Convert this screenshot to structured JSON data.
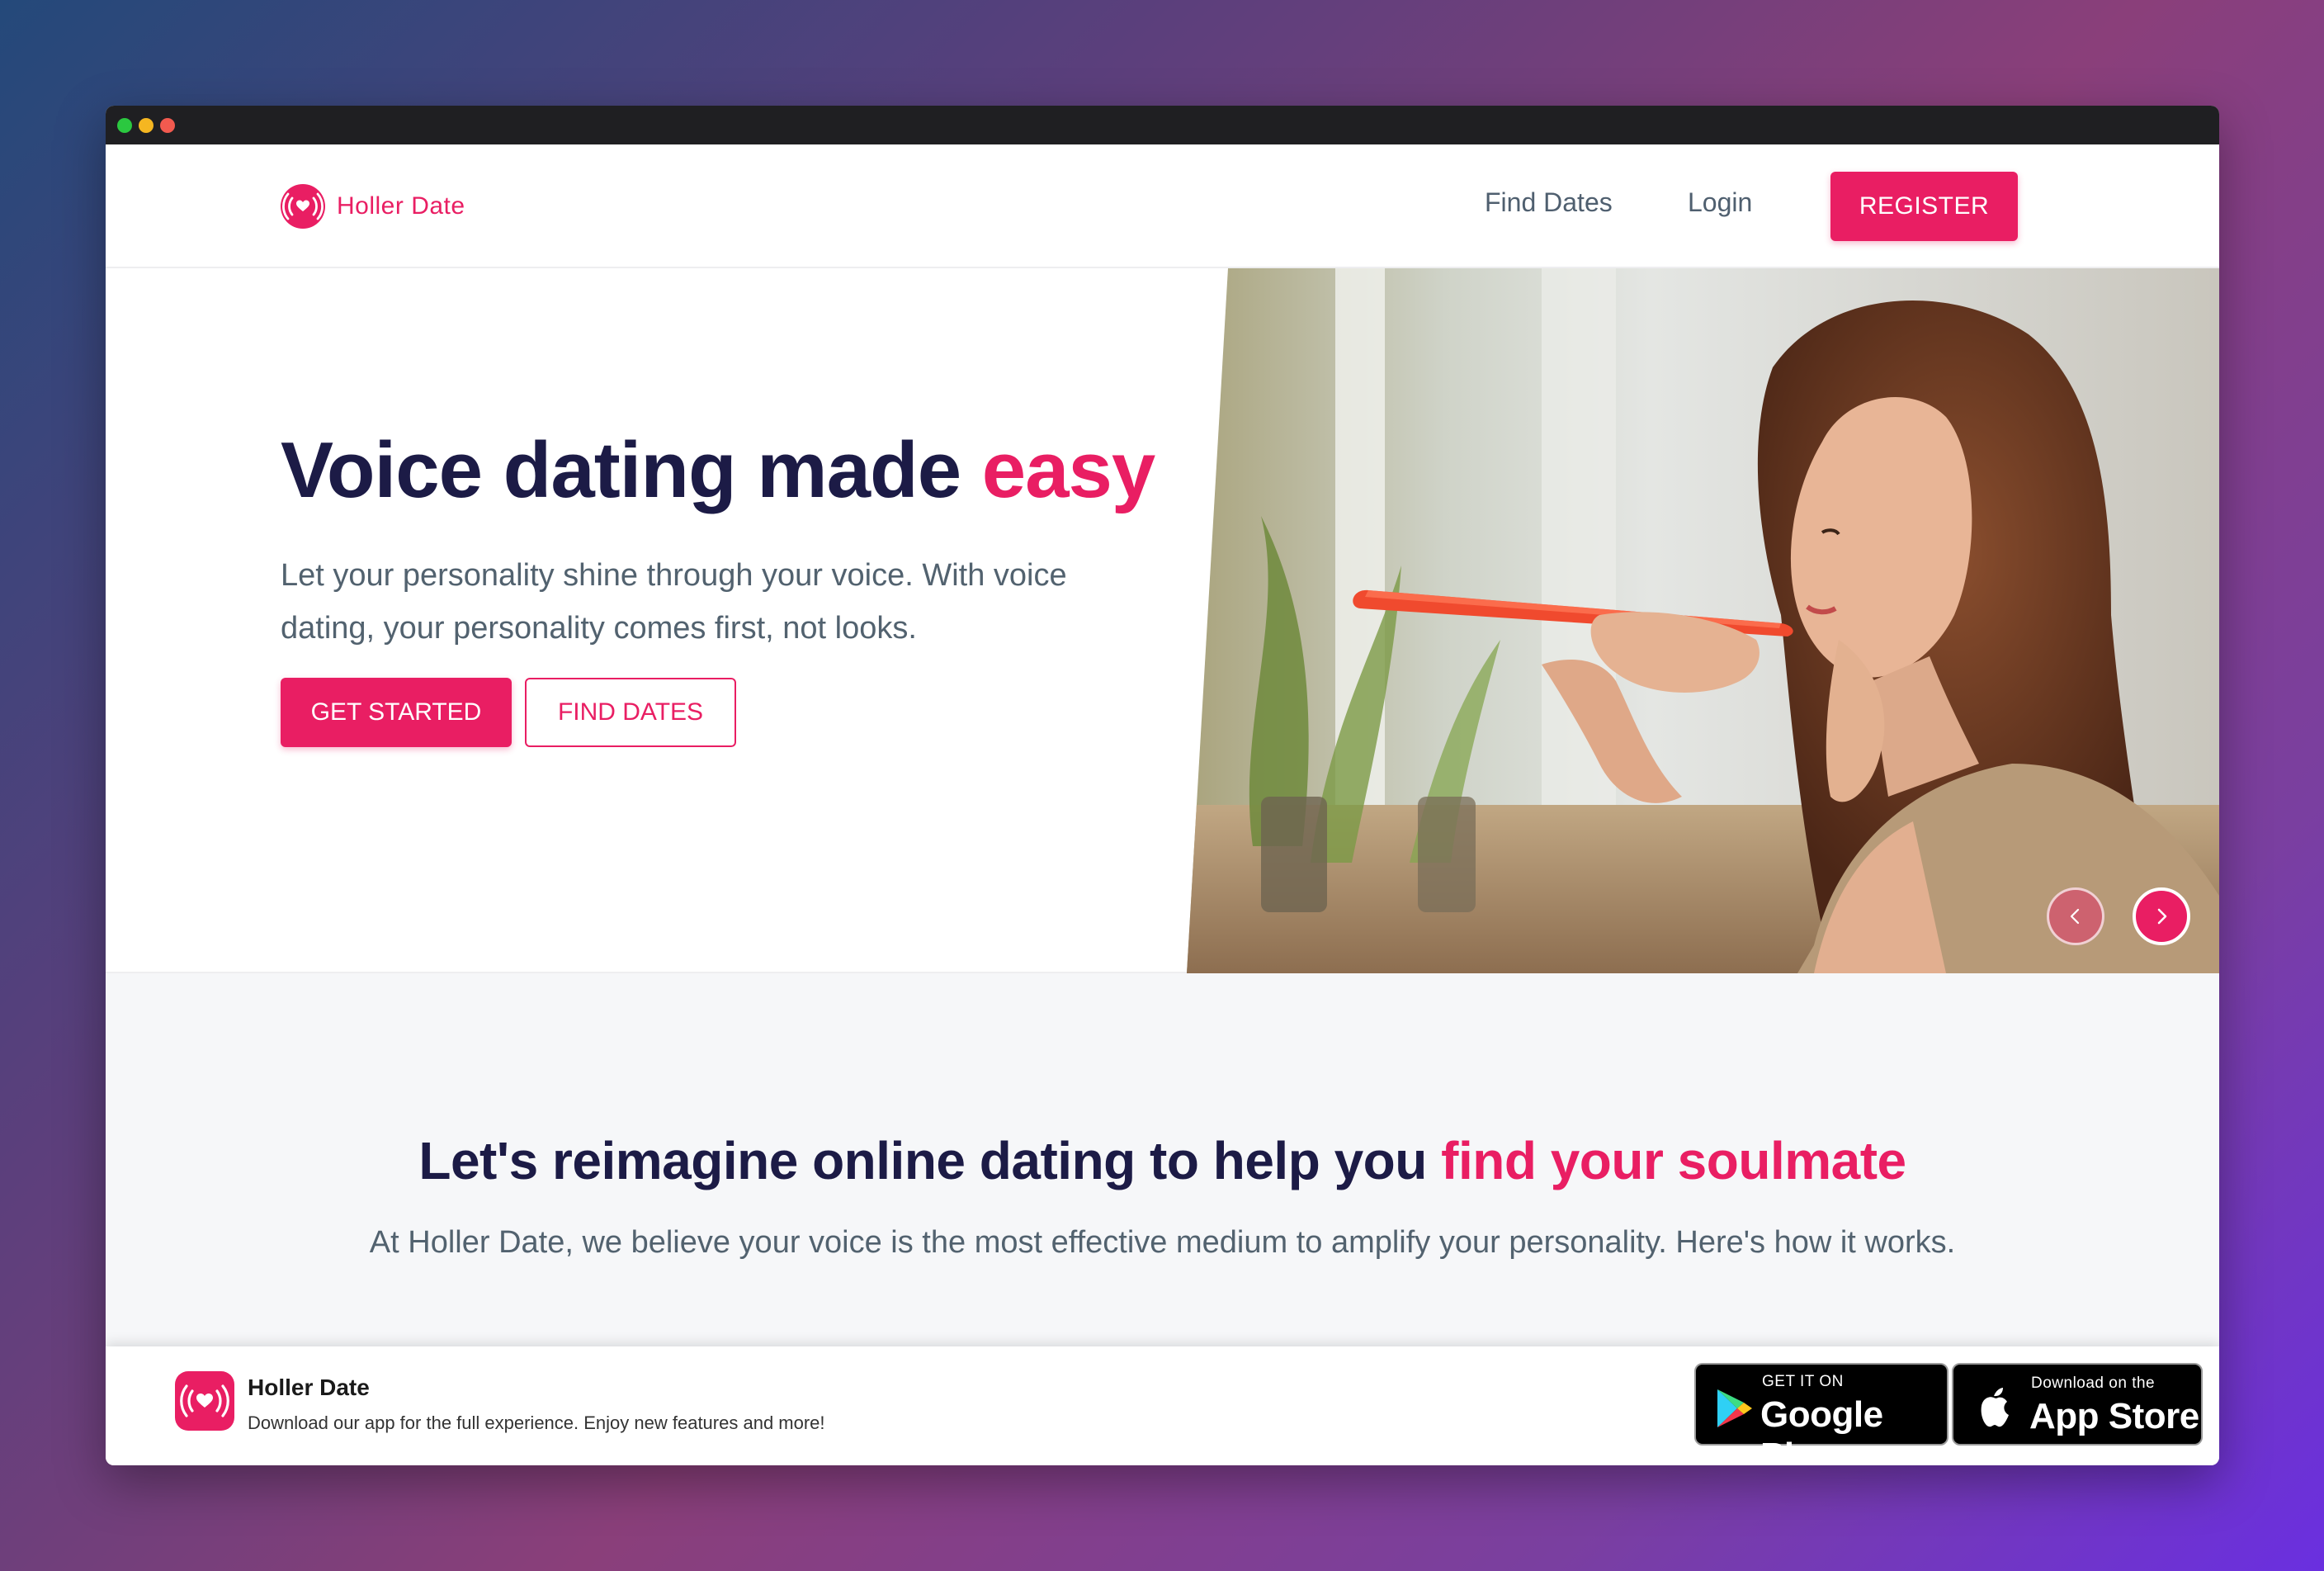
{
  "brand": {
    "name": "Holler Date",
    "color": "#e91e63"
  },
  "nav": {
    "find_dates": "Find Dates",
    "login": "Login",
    "register": "REGISTER"
  },
  "hero": {
    "title_main": "Voice dating made ",
    "title_accent": "easy",
    "subtitle": "Let your personality shine through your voice. With voice dating, your personality comes first, not looks.",
    "primary_cta": "GET STARTED",
    "secondary_cta": "FIND DATES"
  },
  "carousel": {
    "prev_icon": "chevron-left-icon",
    "next_icon": "chevron-right-icon"
  },
  "section": {
    "title_main": "Let's reimagine online dating to help you ",
    "title_accent": "find your soulmate",
    "subtitle": "At Holler Date, we believe your voice is the most effective medium to amplify your personality. Here's how it works."
  },
  "app_banner": {
    "name": "Holler Date",
    "description": "Download our app for the full experience. Enjoy new features and more!",
    "google_small": "GET IT ON",
    "google_big": "Google Play",
    "apple_small": "Download on the",
    "apple_big": "App Store"
  },
  "colors": {
    "accent": "#e91e63",
    "heading": "#1c1b46",
    "body_text": "#52626f"
  }
}
